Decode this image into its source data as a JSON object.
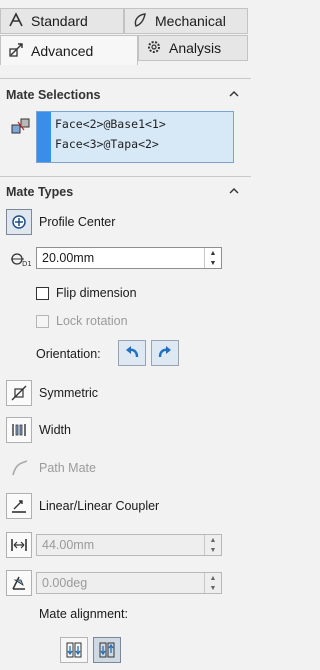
{
  "tabs": [
    {
      "label": "Standard",
      "icon": "standard-mate-icon"
    },
    {
      "label": "Mechanical",
      "icon": "mechanical-mate-icon"
    },
    {
      "label": "Advanced",
      "icon": "advanced-mate-icon"
    },
    {
      "label": "Analysis",
      "icon": "analysis-gear-icon"
    }
  ],
  "mate_selections": {
    "title": "Mate Selections",
    "items": [
      "Face<2>@Base1<1>",
      "Face<3>@Tapa<2>"
    ]
  },
  "mate_types": {
    "title": "Mate Types",
    "profile_center": "Profile Center",
    "offset_value": "20.00mm",
    "flip_dimension": "Flip dimension",
    "lock_rotation": "Lock rotation",
    "orientation_label": "Orientation:",
    "symmetric": "Symmetric",
    "width": "Width",
    "path_mate": "Path Mate",
    "linear_coupler": "Linear/Linear Coupler",
    "distance_value": "44.00mm",
    "angle_value": "0.00deg",
    "mate_alignment_label": "Mate alignment:"
  },
  "colors": {
    "selection_bg": "#d7e8f7",
    "selection_bar": "#3b8ee8",
    "accent_blue": "#1f6fc2"
  }
}
